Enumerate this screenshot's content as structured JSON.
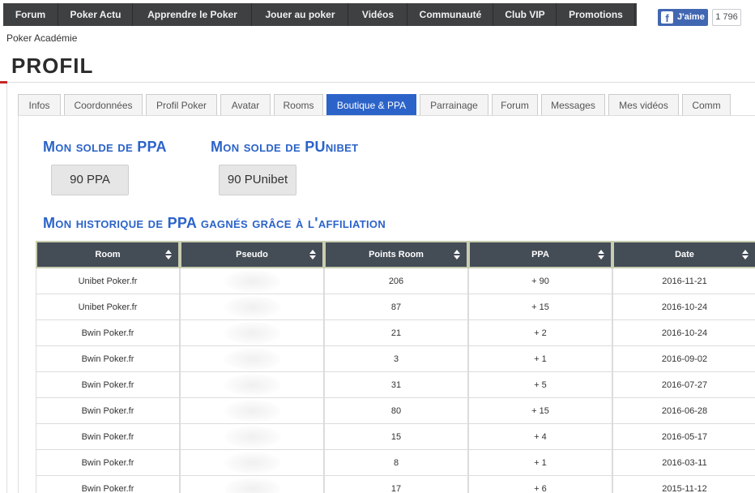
{
  "nav": {
    "items": [
      "Forum",
      "Poker Actu",
      "Apprendre le Poker",
      "Jouer au poker",
      "Vidéos",
      "Communauté",
      "Club VIP",
      "Promotions"
    ]
  },
  "facebook": {
    "like_label": "J'aime",
    "like_count": "1 796",
    "logo": "f"
  },
  "breadcrumb": "Poker Académie",
  "page_title": "PROFIL",
  "tabs": [
    "Infos",
    "Coordonnées",
    "Profil Poker",
    "Avatar",
    "Rooms",
    "Boutique & PPA",
    "Parrainage",
    "Forum",
    "Messages",
    "Mes vidéos",
    "Comm"
  ],
  "active_tab": "Boutique & PPA",
  "balances": {
    "ppa_heading": "Mon solde de PPA",
    "ppa_value": "90 PPA",
    "punibet_heading": "Mon solde de PUnibet",
    "punibet_value": "90 PUnibet"
  },
  "history": {
    "heading": "Mon historique de PPA gagnés grâce à l'affiliation",
    "columns": [
      "Room",
      "Pseudo",
      "Points Room",
      "PPA",
      "Date"
    ],
    "rows": [
      [
        "Unibet Poker.fr",
        "",
        "206",
        "+ 90",
        "2016-11-21"
      ],
      [
        "Unibet Poker.fr",
        "",
        "87",
        "+ 15",
        "2016-10-24"
      ],
      [
        "Bwin Poker.fr",
        "",
        "21",
        "+ 2",
        "2016-10-24"
      ],
      [
        "Bwin Poker.fr",
        "",
        "3",
        "+ 1",
        "2016-09-02"
      ],
      [
        "Bwin Poker.fr",
        "",
        "31",
        "+ 5",
        "2016-07-27"
      ],
      [
        "Bwin Poker.fr",
        "",
        "80",
        "+ 15",
        "2016-06-28"
      ],
      [
        "Bwin Poker.fr",
        "",
        "15",
        "+ 4",
        "2016-05-17"
      ],
      [
        "Bwin Poker.fr",
        "",
        "8",
        "+ 1",
        "2016-03-11"
      ],
      [
        "Bwin Poker.fr",
        "",
        "17",
        "+ 6",
        "2015-11-12"
      ]
    ]
  },
  "colors": {
    "accent": "#2b63c9",
    "nav_bg": "#3e4042",
    "table_header": "#444c56"
  }
}
